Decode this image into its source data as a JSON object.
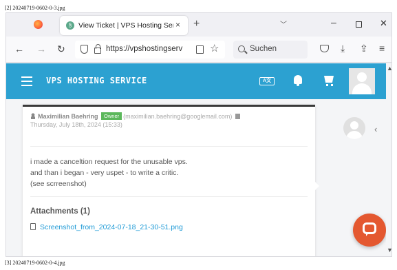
{
  "labels": {
    "top": "[2] 20240719-0602-0-3.jpg",
    "bottom": "[3] 20240719-0602-0-4.jpg"
  },
  "browser": {
    "tab_title": "View Ticket | VPS Hosting Servic",
    "tab_close": "×",
    "new_tab": "+",
    "list_tabs": "﹀",
    "minimize": "–",
    "close": "✕",
    "back": "←",
    "forward": "→",
    "reload": "↻",
    "url": "https://vpshostingserv",
    "bookmark": "☆",
    "search_placeholder": "Suchen",
    "download": "⤓",
    "share": "⇪",
    "menu": "≡"
  },
  "app": {
    "brand": "VPS HOSTING SERVICE",
    "lang_label": "A文"
  },
  "ticket": {
    "author": "Maximilian Baehring",
    "role": "Owner",
    "email": "(maximilian.baehring@googlemail.com)",
    "date": "Thursday, July 18th, 2024 (15:33)",
    "message_lines": [
      "i made a canceltion request for the unusable vps.",
      "and than i began - very uspet - to write a critic.",
      "(see scrreenshot)"
    ],
    "attachments_heading": "Attachments (1)",
    "attachment_file": "Screenshot_from_2024-07-18_21-30-51.png"
  },
  "side": {
    "chevron": "‹"
  },
  "scroll": {
    "up": "▲",
    "down": "▼"
  },
  "colors": {
    "header": "#2ca1d1",
    "owner_badge": "#5cb85c",
    "link": "#1e9ad6",
    "chat_button": "#e45830"
  },
  "icons": [
    "firefox-logo-icon",
    "tab-favicon-icon",
    "shield-icon",
    "lock-icon",
    "reader-view-icon",
    "star-icon",
    "search-icon",
    "pocket-icon",
    "download-icon",
    "share-icon",
    "menu-icon",
    "hamburger-icon",
    "language-icon",
    "bell-icon",
    "cart-icon",
    "user-icon",
    "trash-icon",
    "file-icon",
    "chat-icon"
  ]
}
